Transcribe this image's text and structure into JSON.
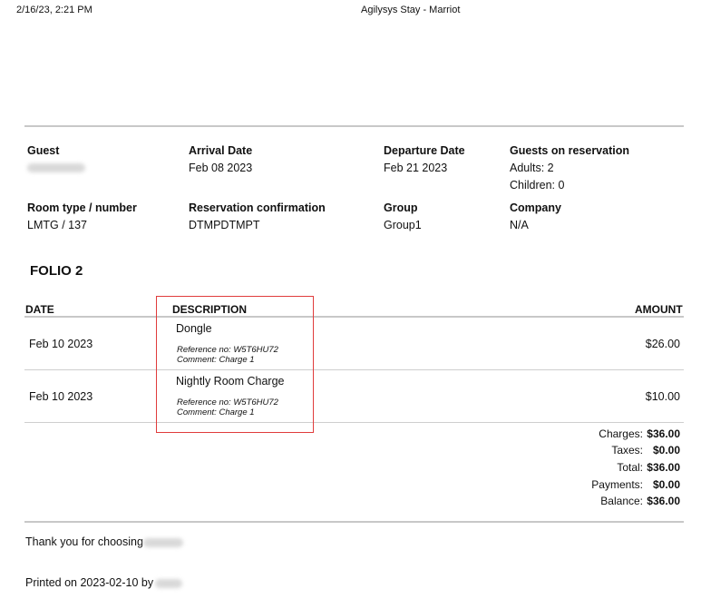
{
  "header": {
    "datetime": "2/16/23, 2:21 PM",
    "title": "Agilysys Stay - Marriot"
  },
  "guest_info": {
    "guest_label": "Guest",
    "arrival_label": "Arrival Date",
    "arrival_value": "Feb 08 2023",
    "departure_label": "Departure Date",
    "departure_value": "Feb 21 2023",
    "guests_label": "Guests on reservation",
    "adults": "Adults: 2",
    "children": "Children: 0",
    "room_label": "Room type / number",
    "room_value": "LMTG / 137",
    "confirmation_label": "Reservation confirmation",
    "confirmation_value": "DTMPDTMPT",
    "group_label": "Group",
    "group_value": "Group1",
    "company_label": "Company",
    "company_value": "N/A"
  },
  "folio": {
    "title": "FOLIO 2",
    "columns": {
      "date": "DATE",
      "description": "DESCRIPTION",
      "amount": "AMOUNT"
    },
    "rows": [
      {
        "date": "Feb 10 2023",
        "description": "Dongle",
        "reference": "Reference no: W5T6HU72",
        "comment": "Comment: Charge 1",
        "amount": "$26.00"
      },
      {
        "date": "Feb 10 2023",
        "description": "Nightly Room Charge",
        "reference": "Reference no: W5T6HU72",
        "comment": "Comment: Charge 1",
        "amount": "$10.00"
      }
    ]
  },
  "summary": {
    "charges_label": "Charges:",
    "charges_value": "$36.00",
    "taxes_label": "Taxes:",
    "taxes_value": "$0.00",
    "total_label": "Total:",
    "total_value": "$36.00",
    "payments_label": "Payments:",
    "payments_value": "$0.00",
    "balance_label": "Balance:",
    "balance_value": "$36.00"
  },
  "footer": {
    "thanks": "Thank you for choosing",
    "printed": "Printed on 2023-02-10 by"
  },
  "colors": {
    "highlight": "#e03c3c",
    "rule": "#c8c8c8"
  }
}
